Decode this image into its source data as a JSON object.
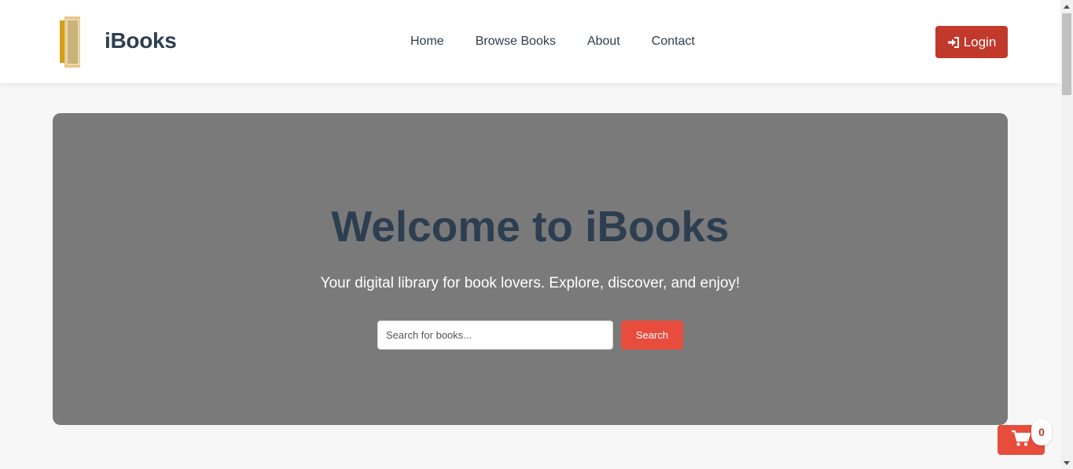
{
  "header": {
    "brand": "iBooks",
    "logo_icon": "book-icon",
    "nav": [
      "Home",
      "Browse Books",
      "About",
      "Contact"
    ],
    "login_label": "Login",
    "login_icon": "sign-in-icon"
  },
  "hero": {
    "title": "Welcome to iBooks",
    "subtitle": "Your digital library for book lovers. Explore, discover, and enjoy!",
    "search_placeholder": "Search for books...",
    "search_button": "Search"
  },
  "cart": {
    "icon": "cart-icon",
    "count": "0"
  },
  "colors": {
    "primary_dark": "#2c3e50",
    "accent_red": "#e74c3c",
    "login_red": "#c0392b",
    "hero_bg": "#7a7a7a",
    "page_bg": "#f7f7f7",
    "logo_gold": "#d4a017"
  }
}
